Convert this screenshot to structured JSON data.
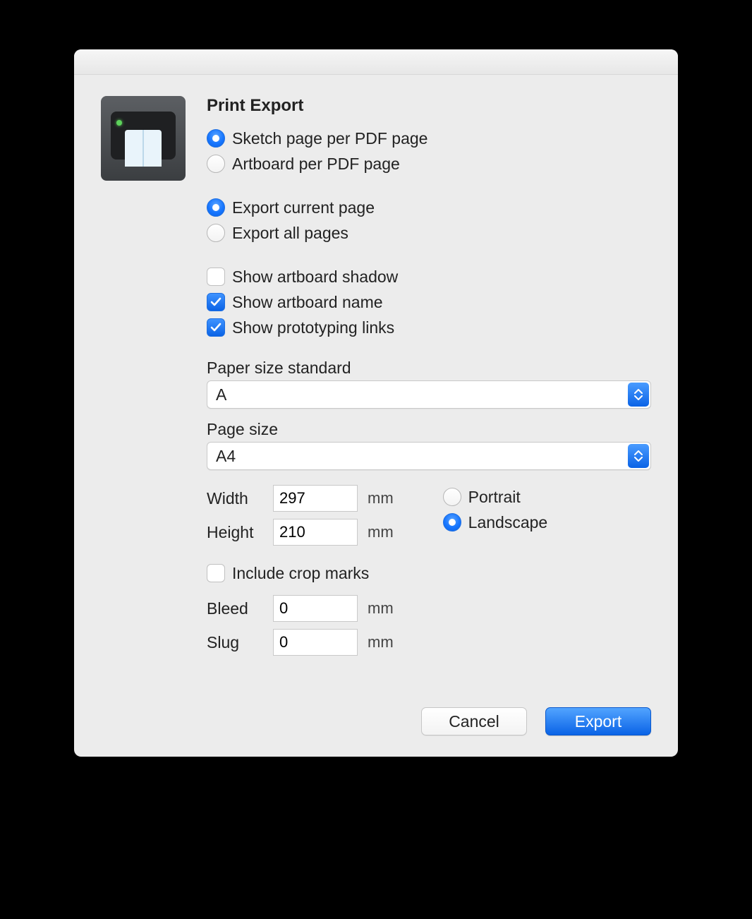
{
  "title": "Print Export",
  "layout_group": {
    "sketch_per_page": {
      "label": "Sketch page per PDF page",
      "selected": true
    },
    "artboard_per_page": {
      "label": "Artboard per PDF page",
      "selected": false
    }
  },
  "scope_group": {
    "current_page": {
      "label": "Export current page",
      "selected": true
    },
    "all_pages": {
      "label": "Export all pages",
      "selected": false
    }
  },
  "options": {
    "show_shadow": {
      "label": "Show artboard shadow",
      "checked": false
    },
    "show_name": {
      "label": "Show artboard name",
      "checked": true
    },
    "show_proto": {
      "label": "Show prototyping links",
      "checked": true
    }
  },
  "paper_standard": {
    "label": "Paper size standard",
    "value": "A"
  },
  "page_size": {
    "label": "Page size",
    "value": "A4"
  },
  "dimensions": {
    "width": {
      "label": "Width",
      "value": "297",
      "unit": "mm"
    },
    "height": {
      "label": "Height",
      "value": "210",
      "unit": "mm"
    }
  },
  "orientation": {
    "portrait": {
      "label": "Portrait",
      "selected": false
    },
    "landscape": {
      "label": "Landscape",
      "selected": true
    }
  },
  "crop_marks": {
    "label": "Include crop marks",
    "checked": false
  },
  "bleed": {
    "label": "Bleed",
    "value": "0",
    "unit": "mm"
  },
  "slug": {
    "label": "Slug",
    "value": "0",
    "unit": "mm"
  },
  "buttons": {
    "cancel": "Cancel",
    "export": "Export"
  }
}
